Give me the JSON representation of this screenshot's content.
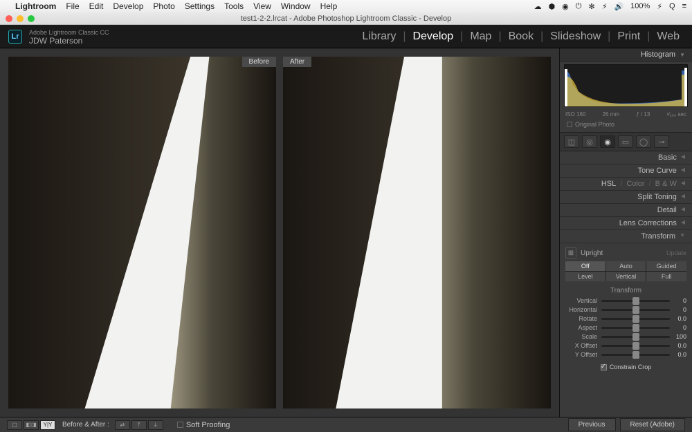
{
  "mac_menu": {
    "app": "Lightroom",
    "items": [
      "File",
      "Edit",
      "Develop",
      "Photo",
      "Settings",
      "Tools",
      "View",
      "Window",
      "Help"
    ],
    "status_right": [
      "☁︎",
      "⬢",
      "◉",
      "⏻",
      "✻",
      "⚡︎",
      "🔊",
      "100%",
      "⚡︎",
      "Q",
      "≡"
    ]
  },
  "doc_title": "test1-2-2.lrcat - Adobe Photoshop Lightroom Classic - Develop",
  "branding": {
    "line1": "Adobe Lightroom Classic CC",
    "line2": "JDW Paterson",
    "logo": "Lr"
  },
  "modules": [
    "Library",
    "Develop",
    "Map",
    "Book",
    "Slideshow",
    "Print",
    "Web"
  ],
  "active_module": "Develop",
  "preview": {
    "before": "Before",
    "after": "After"
  },
  "histogram": {
    "title": "Histogram",
    "iso": "ISO 160",
    "focal": "26 mm",
    "aperture": "ƒ / 13",
    "shutter": "¹⁄₂₀₀ sec",
    "original_photo": "Original Photo"
  },
  "sections": {
    "basic": "Basic",
    "tone_curve": "Tone Curve",
    "hsl": "HSL",
    "color": "Color",
    "bw": "B & W",
    "split_toning": "Split Toning",
    "detail": "Detail",
    "lens": "Lens Corrections",
    "transform": "Transform"
  },
  "transform": {
    "upright_label": "Upright",
    "update": "Update",
    "buttons": [
      "Off",
      "Auto",
      "Guided",
      "Level",
      "Vertical",
      "Full"
    ],
    "group_title": "Transform",
    "sliders": [
      {
        "label": "Vertical",
        "value": "0",
        "pos": 50
      },
      {
        "label": "Horizontal",
        "value": "0",
        "pos": 50
      },
      {
        "label": "Rotate",
        "value": "0.0",
        "pos": 50
      },
      {
        "label": "Aspect",
        "value": "0",
        "pos": 50
      },
      {
        "label": "Scale",
        "value": "100",
        "pos": 50
      },
      {
        "label": "X Offset",
        "value": "0.0",
        "pos": 50
      },
      {
        "label": "Y Offset",
        "value": "0.0",
        "pos": 50
      }
    ],
    "constrain": "Constrain Crop"
  },
  "bottom": {
    "before_after_label": "Before & After :",
    "soft_proof": "Soft Proofing",
    "previous": "Previous",
    "reset": "Reset (Adobe)"
  }
}
